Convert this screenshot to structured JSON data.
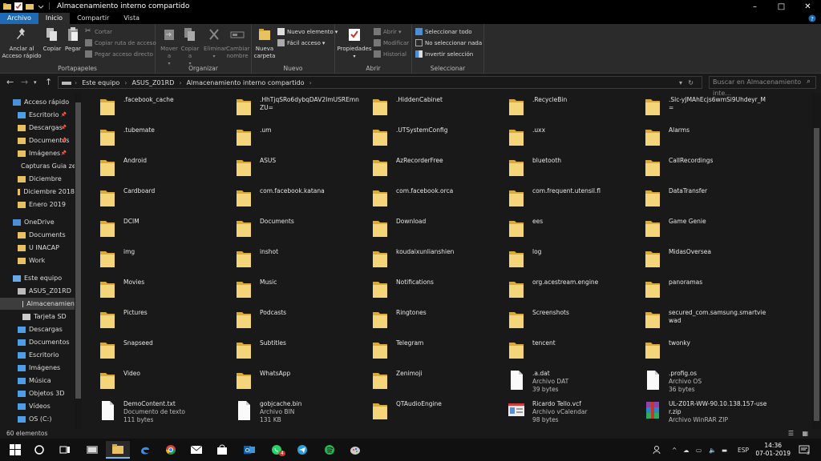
{
  "window": {
    "title": "Almacenamiento interno compartido",
    "controls": [
      "–",
      "□",
      "✕"
    ]
  },
  "ribbon_tabs": [
    "Archivo",
    "Inicio",
    "Compartir",
    "Vista"
  ],
  "ribbon": {
    "portapapeles": {
      "label": "Portapapeles",
      "pin": "Anclar al Acceso rápido",
      "copy": "Copiar",
      "paste": "Pegar",
      "cut": "Cortar",
      "copy_path": "Copiar ruta de acceso",
      "paste_shortcut": "Pegar acceso directo"
    },
    "organizar": {
      "label": "Organizar",
      "move": "Mover a",
      "copy": "Copiar a",
      "delete": "Eliminar",
      "rename": "Cambiar nombre"
    },
    "nuevo": {
      "label": "Nuevo",
      "new_folder": "Nueva carpeta",
      "new_item": "Nuevo elemento",
      "easy_access": "Fácil acceso"
    },
    "abrir": {
      "label": "Abrir",
      "properties": "Propiedades",
      "open": "Abrir",
      "edit": "Modificar",
      "history": "Historial"
    },
    "seleccion": {
      "label": "Seleccionar",
      "select_all": "Seleccionar todo",
      "select_none": "No seleccionar nada",
      "invert": "Invertir selección"
    }
  },
  "address": {
    "breadcrumb": [
      "Este equipo",
      "ASUS_Z01RD",
      "Almacenamiento interno compartido"
    ],
    "search_placeholder": "Buscar en Almacenamiento inte..."
  },
  "nav": {
    "quick_access": "Acceso rápido",
    "quick_items": [
      "Escritorio",
      "Descargas",
      "Documentos",
      "Imágenes",
      "Capturas Guia ze",
      "Diciembre",
      "Diciembre 2018",
      "Enero 2019"
    ],
    "onedrive": "OneDrive",
    "onedrive_items": [
      "Documents",
      "U INACAP",
      "Work"
    ],
    "this_pc": "Este equipo",
    "device": "ASUS_Z01RD",
    "device_items": [
      "Almacenamien",
      "Tarjeta SD"
    ],
    "pc_items": [
      "Descargas",
      "Documentos",
      "Escritorio",
      "Imágenes",
      "Música",
      "Objetos 3D",
      "Vídeos",
      "OS (C:)"
    ]
  },
  "files": [
    {
      "name": ".facebook_cache",
      "kind": "folder"
    },
    {
      "name": ".HhTjqSRo6dybqDAV2ImUSREmnZU=",
      "kind": "folder"
    },
    {
      "name": ".HiddenCabinet",
      "kind": "folder"
    },
    {
      "name": ".RecycleBin",
      "kind": "folder"
    },
    {
      "name": ".Slc-yJMAhEcjs6wmSi9Uhdeyr_M=",
      "kind": "folder"
    },
    {
      "name": ".tubemate",
      "kind": "folder"
    },
    {
      "name": ".um",
      "kind": "folder"
    },
    {
      "name": ".UTSystemConfig",
      "kind": "folder"
    },
    {
      "name": ".uxx",
      "kind": "folder"
    },
    {
      "name": "Alarms",
      "kind": "folder"
    },
    {
      "name": "Android",
      "kind": "folder"
    },
    {
      "name": "ASUS",
      "kind": "folder"
    },
    {
      "name": "AzRecorderFree",
      "kind": "folder"
    },
    {
      "name": "bluetooth",
      "kind": "folder"
    },
    {
      "name": "CallRecordings",
      "kind": "folder"
    },
    {
      "name": "Cardboard",
      "kind": "folder"
    },
    {
      "name": "com.facebook.katana",
      "kind": "folder"
    },
    {
      "name": "com.facebook.orca",
      "kind": "folder"
    },
    {
      "name": "com.frequent.utensil.fl",
      "kind": "folder"
    },
    {
      "name": "DataTransfer",
      "kind": "folder"
    },
    {
      "name": "DCIM",
      "kind": "folder"
    },
    {
      "name": "Documents",
      "kind": "folder"
    },
    {
      "name": "Download",
      "kind": "folder"
    },
    {
      "name": "ees",
      "kind": "folder"
    },
    {
      "name": "Game Genie",
      "kind": "folder"
    },
    {
      "name": "img",
      "kind": "folder"
    },
    {
      "name": "inshot",
      "kind": "folder"
    },
    {
      "name": "koudaixunlianshien",
      "kind": "folder"
    },
    {
      "name": "log",
      "kind": "folder"
    },
    {
      "name": "MidasOversea",
      "kind": "folder"
    },
    {
      "name": "Movies",
      "kind": "folder"
    },
    {
      "name": "Music",
      "kind": "folder"
    },
    {
      "name": "Notifications",
      "kind": "folder"
    },
    {
      "name": "org.acestream.engine",
      "kind": "folder"
    },
    {
      "name": "panoramas",
      "kind": "folder"
    },
    {
      "name": "Pictures",
      "kind": "folder"
    },
    {
      "name": "Podcasts",
      "kind": "folder"
    },
    {
      "name": "Ringtones",
      "kind": "folder"
    },
    {
      "name": "Screenshots",
      "kind": "folder"
    },
    {
      "name": "secured_com.samsung.smartviewad",
      "kind": "folder"
    },
    {
      "name": "Snapseed",
      "kind": "folder"
    },
    {
      "name": "Subtitles",
      "kind": "folder"
    },
    {
      "name": "Telegram",
      "kind": "folder"
    },
    {
      "name": "tencent",
      "kind": "folder"
    },
    {
      "name": "twonky",
      "kind": "folder"
    },
    {
      "name": "Video",
      "kind": "folder"
    },
    {
      "name": "WhatsApp",
      "kind": "folder"
    },
    {
      "name": "Zenimoji",
      "kind": "folder"
    },
    {
      "name": ".a.dat",
      "kind": "file",
      "type": "Archivo DAT",
      "size": "39 bytes"
    },
    {
      "name": ".profig.os",
      "kind": "file",
      "type": "Archivo OS",
      "size": "36 bytes"
    },
    {
      "name": "DemoContent.txt",
      "kind": "file",
      "type": "Documento de texto",
      "size": "111 bytes"
    },
    {
      "name": "gobjcache.bin",
      "kind": "file",
      "type": "Archivo BIN",
      "size": "131 KB"
    },
    {
      "name": "QTAudioEngine",
      "kind": "folder"
    },
    {
      "name": "Ricardo Tello.vcf",
      "kind": "vcard",
      "type": "Archivo vCalendar",
      "size": "98 bytes"
    },
    {
      "name": "UL-Z01R-WW-90.10.138.157-user.zip",
      "kind": "zip",
      "type": "Archivo WinRAR ZIP",
      "size": ""
    }
  ],
  "status": "60 elementos",
  "taskbar": {
    "lang": "ESP",
    "time": "14:36",
    "date": "07-01-2019",
    "notification_count": "3",
    "outlook_badge": "4"
  }
}
